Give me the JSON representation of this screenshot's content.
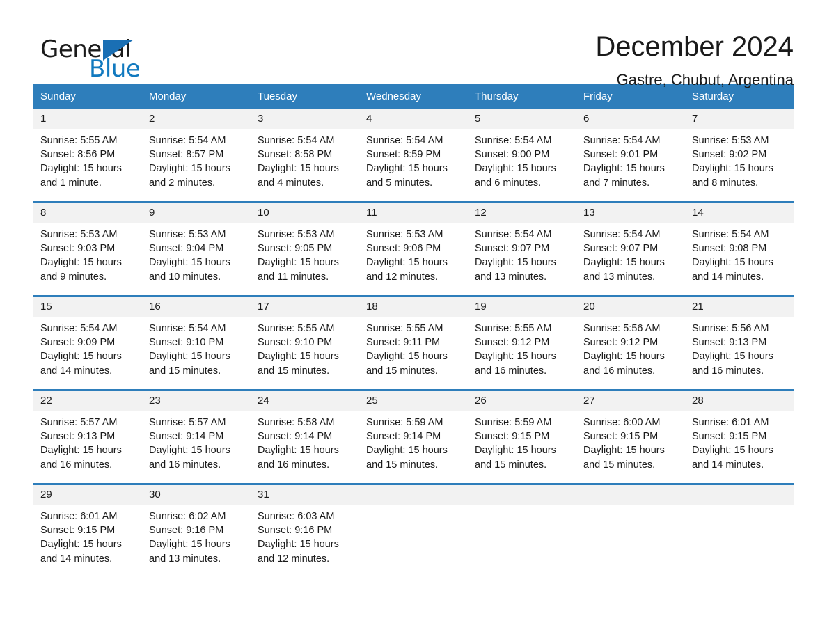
{
  "logo": {
    "word_one": "General",
    "word_two": "Blue",
    "triangle_icon": "triangle-icon",
    "brand_blue": "#1179bf",
    "triangle_blue": "#1a6fb4"
  },
  "header": {
    "title": "December 2024",
    "subtitle": "Gastre, Chubut, Argentina"
  },
  "theme": {
    "header_bar": "#2e7ebb",
    "day_number_bg": "#f2f2f2",
    "text": "#1a1a1a",
    "page_bg": "#ffffff"
  },
  "weekdays": [
    "Sunday",
    "Monday",
    "Tuesday",
    "Wednesday",
    "Thursday",
    "Friday",
    "Saturday"
  ],
  "labels": {
    "sunrise": "Sunrise:",
    "sunset": "Sunset:",
    "daylight": "Daylight:"
  },
  "weeks": [
    [
      {
        "day": "1",
        "sunrise": "Sunrise: 5:55 AM",
        "sunset": "Sunset: 8:56 PM",
        "daylight_line1": "Daylight: 15 hours",
        "daylight_line2": "and 1 minute."
      },
      {
        "day": "2",
        "sunrise": "Sunrise: 5:54 AM",
        "sunset": "Sunset: 8:57 PM",
        "daylight_line1": "Daylight: 15 hours",
        "daylight_line2": "and 2 minutes."
      },
      {
        "day": "3",
        "sunrise": "Sunrise: 5:54 AM",
        "sunset": "Sunset: 8:58 PM",
        "daylight_line1": "Daylight: 15 hours",
        "daylight_line2": "and 4 minutes."
      },
      {
        "day": "4",
        "sunrise": "Sunrise: 5:54 AM",
        "sunset": "Sunset: 8:59 PM",
        "daylight_line1": "Daylight: 15 hours",
        "daylight_line2": "and 5 minutes."
      },
      {
        "day": "5",
        "sunrise": "Sunrise: 5:54 AM",
        "sunset": "Sunset: 9:00 PM",
        "daylight_line1": "Daylight: 15 hours",
        "daylight_line2": "and 6 minutes."
      },
      {
        "day": "6",
        "sunrise": "Sunrise: 5:54 AM",
        "sunset": "Sunset: 9:01 PM",
        "daylight_line1": "Daylight: 15 hours",
        "daylight_line2": "and 7 minutes."
      },
      {
        "day": "7",
        "sunrise": "Sunrise: 5:53 AM",
        "sunset": "Sunset: 9:02 PM",
        "daylight_line1": "Daylight: 15 hours",
        "daylight_line2": "and 8 minutes."
      }
    ],
    [
      {
        "day": "8",
        "sunrise": "Sunrise: 5:53 AM",
        "sunset": "Sunset: 9:03 PM",
        "daylight_line1": "Daylight: 15 hours",
        "daylight_line2": "and 9 minutes."
      },
      {
        "day": "9",
        "sunrise": "Sunrise: 5:53 AM",
        "sunset": "Sunset: 9:04 PM",
        "daylight_line1": "Daylight: 15 hours",
        "daylight_line2": "and 10 minutes."
      },
      {
        "day": "10",
        "sunrise": "Sunrise: 5:53 AM",
        "sunset": "Sunset: 9:05 PM",
        "daylight_line1": "Daylight: 15 hours",
        "daylight_line2": "and 11 minutes."
      },
      {
        "day": "11",
        "sunrise": "Sunrise: 5:53 AM",
        "sunset": "Sunset: 9:06 PM",
        "daylight_line1": "Daylight: 15 hours",
        "daylight_line2": "and 12 minutes."
      },
      {
        "day": "12",
        "sunrise": "Sunrise: 5:54 AM",
        "sunset": "Sunset: 9:07 PM",
        "daylight_line1": "Daylight: 15 hours",
        "daylight_line2": "and 13 minutes."
      },
      {
        "day": "13",
        "sunrise": "Sunrise: 5:54 AM",
        "sunset": "Sunset: 9:07 PM",
        "daylight_line1": "Daylight: 15 hours",
        "daylight_line2": "and 13 minutes."
      },
      {
        "day": "14",
        "sunrise": "Sunrise: 5:54 AM",
        "sunset": "Sunset: 9:08 PM",
        "daylight_line1": "Daylight: 15 hours",
        "daylight_line2": "and 14 minutes."
      }
    ],
    [
      {
        "day": "15",
        "sunrise": "Sunrise: 5:54 AM",
        "sunset": "Sunset: 9:09 PM",
        "daylight_line1": "Daylight: 15 hours",
        "daylight_line2": "and 14 minutes."
      },
      {
        "day": "16",
        "sunrise": "Sunrise: 5:54 AM",
        "sunset": "Sunset: 9:10 PM",
        "daylight_line1": "Daylight: 15 hours",
        "daylight_line2": "and 15 minutes."
      },
      {
        "day": "17",
        "sunrise": "Sunrise: 5:55 AM",
        "sunset": "Sunset: 9:10 PM",
        "daylight_line1": "Daylight: 15 hours",
        "daylight_line2": "and 15 minutes."
      },
      {
        "day": "18",
        "sunrise": "Sunrise: 5:55 AM",
        "sunset": "Sunset: 9:11 PM",
        "daylight_line1": "Daylight: 15 hours",
        "daylight_line2": "and 15 minutes."
      },
      {
        "day": "19",
        "sunrise": "Sunrise: 5:55 AM",
        "sunset": "Sunset: 9:12 PM",
        "daylight_line1": "Daylight: 15 hours",
        "daylight_line2": "and 16 minutes."
      },
      {
        "day": "20",
        "sunrise": "Sunrise: 5:56 AM",
        "sunset": "Sunset: 9:12 PM",
        "daylight_line1": "Daylight: 15 hours",
        "daylight_line2": "and 16 minutes."
      },
      {
        "day": "21",
        "sunrise": "Sunrise: 5:56 AM",
        "sunset": "Sunset: 9:13 PM",
        "daylight_line1": "Daylight: 15 hours",
        "daylight_line2": "and 16 minutes."
      }
    ],
    [
      {
        "day": "22",
        "sunrise": "Sunrise: 5:57 AM",
        "sunset": "Sunset: 9:13 PM",
        "daylight_line1": "Daylight: 15 hours",
        "daylight_line2": "and 16 minutes."
      },
      {
        "day": "23",
        "sunrise": "Sunrise: 5:57 AM",
        "sunset": "Sunset: 9:14 PM",
        "daylight_line1": "Daylight: 15 hours",
        "daylight_line2": "and 16 minutes."
      },
      {
        "day": "24",
        "sunrise": "Sunrise: 5:58 AM",
        "sunset": "Sunset: 9:14 PM",
        "daylight_line1": "Daylight: 15 hours",
        "daylight_line2": "and 16 minutes."
      },
      {
        "day": "25",
        "sunrise": "Sunrise: 5:59 AM",
        "sunset": "Sunset: 9:14 PM",
        "daylight_line1": "Daylight: 15 hours",
        "daylight_line2": "and 15 minutes."
      },
      {
        "day": "26",
        "sunrise": "Sunrise: 5:59 AM",
        "sunset": "Sunset: 9:15 PM",
        "daylight_line1": "Daylight: 15 hours",
        "daylight_line2": "and 15 minutes."
      },
      {
        "day": "27",
        "sunrise": "Sunrise: 6:00 AM",
        "sunset": "Sunset: 9:15 PM",
        "daylight_line1": "Daylight: 15 hours",
        "daylight_line2": "and 15 minutes."
      },
      {
        "day": "28",
        "sunrise": "Sunrise: 6:01 AM",
        "sunset": "Sunset: 9:15 PM",
        "daylight_line1": "Daylight: 15 hours",
        "daylight_line2": "and 14 minutes."
      }
    ],
    [
      {
        "day": "29",
        "sunrise": "Sunrise: 6:01 AM",
        "sunset": "Sunset: 9:15 PM",
        "daylight_line1": "Daylight: 15 hours",
        "daylight_line2": "and 14 minutes."
      },
      {
        "day": "30",
        "sunrise": "Sunrise: 6:02 AM",
        "sunset": "Sunset: 9:16 PM",
        "daylight_line1": "Daylight: 15 hours",
        "daylight_line2": "and 13 minutes."
      },
      {
        "day": "31",
        "sunrise": "Sunrise: 6:03 AM",
        "sunset": "Sunset: 9:16 PM",
        "daylight_line1": "Daylight: 15 hours",
        "daylight_line2": "and 12 minutes."
      },
      {
        "day": "",
        "sunrise": "",
        "sunset": "",
        "daylight_line1": "",
        "daylight_line2": ""
      },
      {
        "day": "",
        "sunrise": "",
        "sunset": "",
        "daylight_line1": "",
        "daylight_line2": ""
      },
      {
        "day": "",
        "sunrise": "",
        "sunset": "",
        "daylight_line1": "",
        "daylight_line2": ""
      },
      {
        "day": "",
        "sunrise": "",
        "sunset": "",
        "daylight_line1": "",
        "daylight_line2": ""
      }
    ]
  ]
}
